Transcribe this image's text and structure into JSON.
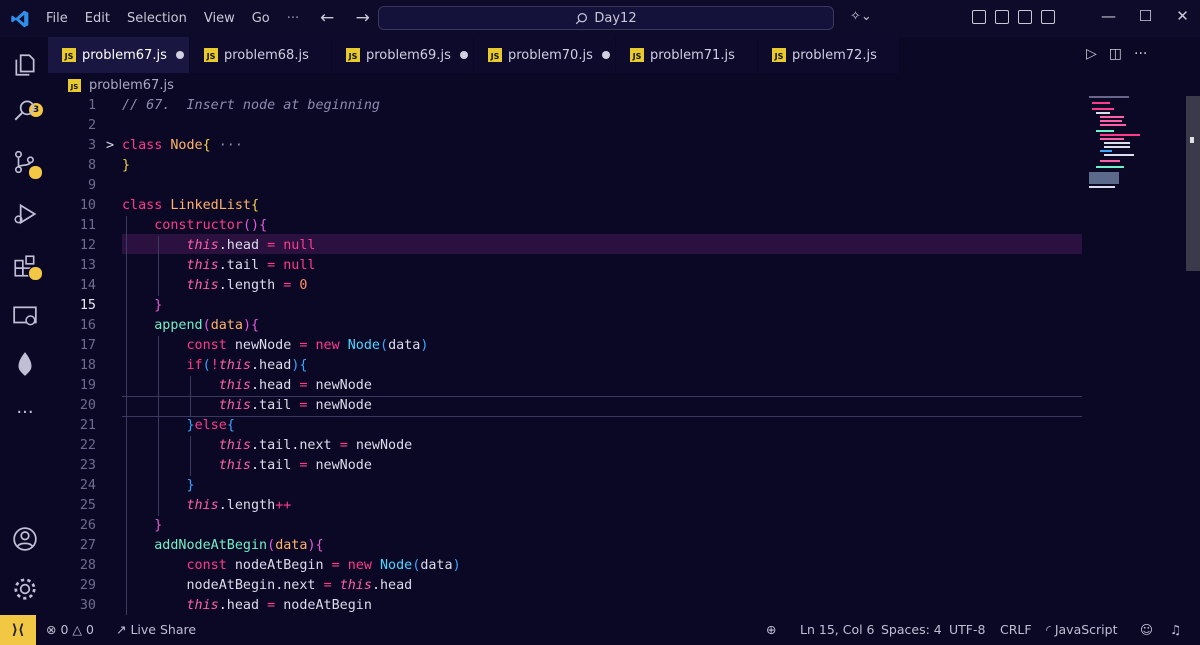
{
  "titlebar": {
    "menu": [
      "File",
      "Edit",
      "Selection",
      "View",
      "Go"
    ],
    "more": "···",
    "nav": "← →",
    "search": "Day12"
  },
  "activity": {
    "badge": "3"
  },
  "tabs": [
    {
      "label": "problem67.js",
      "active": true,
      "dot": true
    },
    {
      "label": "problem68.js",
      "active": false,
      "dot": false
    },
    {
      "label": "problem69.js",
      "active": false,
      "dot": true
    },
    {
      "label": "problem70.js",
      "active": false,
      "dot": true
    },
    {
      "label": "problem71.js",
      "active": false,
      "dot": false
    },
    {
      "label": "problem72.js",
      "active": false,
      "dot": false
    }
  ],
  "breadcrumb": "problem67.js",
  "editor": {
    "current_line": "15",
    "lines": [
      {
        "n": "1"
      },
      {
        "n": "2"
      },
      {
        "n": "3"
      },
      {
        "n": "8"
      },
      {
        "n": "9"
      },
      {
        "n": "10"
      },
      {
        "n": "11"
      },
      {
        "n": "12"
      },
      {
        "n": "13"
      },
      {
        "n": "14"
      },
      {
        "n": "15"
      },
      {
        "n": "16"
      },
      {
        "n": "17"
      },
      {
        "n": "18"
      },
      {
        "n": "19"
      },
      {
        "n": "20"
      },
      {
        "n": "21"
      },
      {
        "n": "22"
      },
      {
        "n": "23"
      },
      {
        "n": "24"
      },
      {
        "n": "25"
      },
      {
        "n": "26"
      },
      {
        "n": "27"
      },
      {
        "n": "28"
      },
      {
        "n": "29"
      },
      {
        "n": "30"
      }
    ]
  },
  "status": {
    "errors": "0",
    "warnings": "0",
    "live_share": "Live Share",
    "position": "Ln 15, Col 6",
    "spaces": "Spaces: 4",
    "encoding": "UTF-8",
    "eol": "CRLF",
    "language": "JavaScript"
  },
  "colors": {
    "background": "#0b0825",
    "keyword": "#ff3a8c",
    "function": "#4dd4ff",
    "accent": "#f2c744"
  }
}
